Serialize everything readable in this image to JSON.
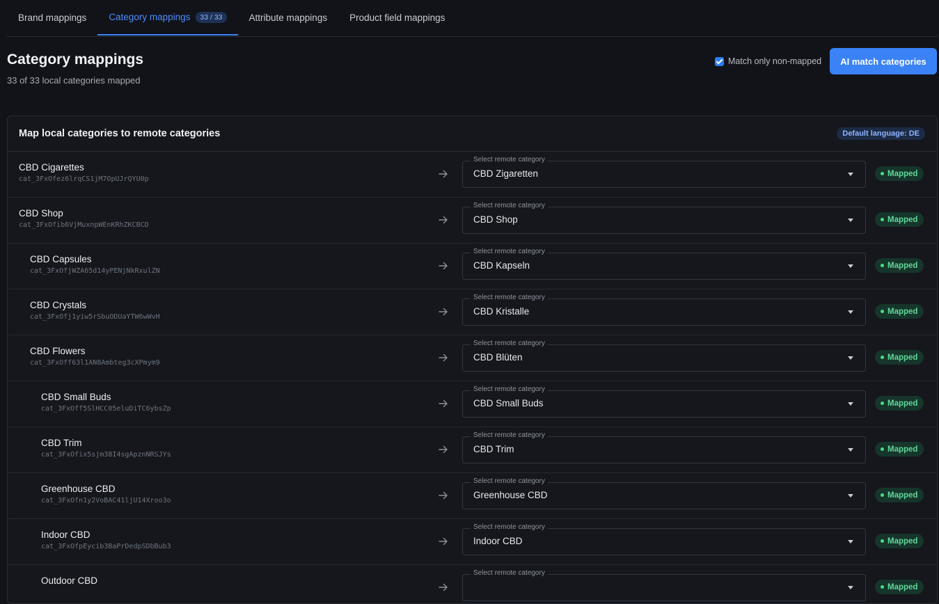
{
  "tabs": [
    {
      "label": "Brand mappings",
      "active": false
    },
    {
      "label": "Category mappings",
      "active": true,
      "badge": "33 / 33"
    },
    {
      "label": "Attribute mappings",
      "active": false
    },
    {
      "label": "Product field mappings",
      "active": false
    }
  ],
  "header": {
    "title": "Category mappings",
    "subtitle": "33 of 33 local categories mapped",
    "match_only_label": "Match only non-mapped",
    "match_only_checked": true,
    "ai_button_label": "AI match categories"
  },
  "panel": {
    "title": "Map local categories to remote categories",
    "language_badge": "Default language: DE",
    "select_label": "Select remote category",
    "rows": [
      {
        "name": "CBD Cigarettes",
        "id": "cat_3FxOfez6lrqCS1jM7OpUJrQYU0p",
        "depth": 0,
        "remote": "CBD Zigaretten",
        "status": "Mapped"
      },
      {
        "name": "CBD Shop",
        "id": "cat_3FxOfib6VjMuxnpWEnKRhZKCBCD",
        "depth": 0,
        "remote": "CBD Shop",
        "status": "Mapped"
      },
      {
        "name": "CBD Capsules",
        "id": "cat_3FxOfjWZA65d14yPENjNkRxulZN",
        "depth": 1,
        "remote": "CBD Kapseln",
        "status": "Mapped"
      },
      {
        "name": "CBD Crystals",
        "id": "cat_3FxOfj1yiw5rSbuODUaYTW6wWvH",
        "depth": 1,
        "remote": "CBD Kristalle",
        "status": "Mapped"
      },
      {
        "name": "CBD Flowers",
        "id": "cat_3FxOff63l1AN8Ambteg3cXPmym9",
        "depth": 1,
        "remote": "CBD Blüten",
        "status": "Mapped"
      },
      {
        "name": "CBD Small Buds",
        "id": "cat_3FxOff5SlHCC05eluDiTC6ybsZp",
        "depth": 2,
        "remote": "CBD Small Buds",
        "status": "Mapped"
      },
      {
        "name": "CBD Trim",
        "id": "cat_3FxOfix5sjm38I4sgApznNRSJYs",
        "depth": 2,
        "remote": "CBD Trim",
        "status": "Mapped"
      },
      {
        "name": "Greenhouse CBD",
        "id": "cat_3FxOfn1y2VoBAC41ljU14Xroo3o",
        "depth": 2,
        "remote": "Greenhouse CBD",
        "status": "Mapped"
      },
      {
        "name": "Indoor CBD",
        "id": "cat_3FxOfpEycib3BaPrDedpSDbBub3",
        "depth": 2,
        "remote": "Indoor CBD",
        "status": "Mapped"
      },
      {
        "name": "Outdoor CBD",
        "id": "",
        "depth": 2,
        "remote": "",
        "status": "Mapped"
      }
    ]
  },
  "colors": {
    "accent": "#3b82f6",
    "mapped": "#4ade80",
    "background": "#111318"
  },
  "icons": {
    "row_arrow": "arrow-right-icon",
    "select_toggle": "chevron-down-icon",
    "status": "status-dot-icon"
  }
}
